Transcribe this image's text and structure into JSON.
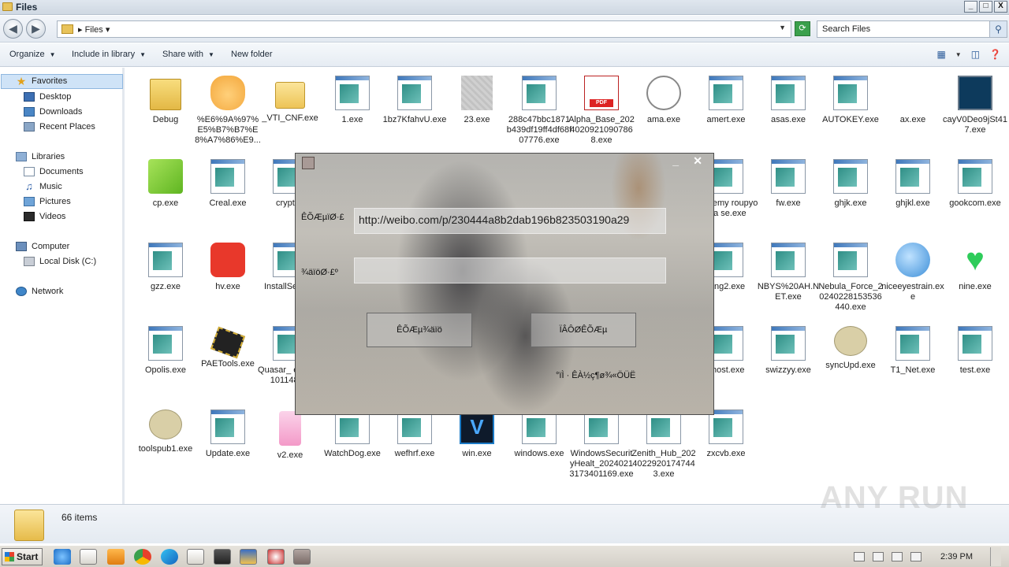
{
  "window": {
    "title": "Files",
    "min": "_",
    "max": "□",
    "close": "X"
  },
  "address": {
    "crumb": "Files",
    "search_placeholder": "Search Files"
  },
  "commands": {
    "organize": "Organize",
    "include": "Include in library",
    "share": "Share with",
    "new_folder": "New folder"
  },
  "nav": {
    "favorites": "Favorites",
    "desktop": "Desktop",
    "downloads": "Downloads",
    "recent": "Recent Places",
    "libraries": "Libraries",
    "documents": "Documents",
    "music": "Music",
    "pictures": "Pictures",
    "videos": "Videos",
    "computer": "Computer",
    "local_disk": "Local Disk (C:)",
    "network": "Network"
  },
  "files": [
    {
      "name": "Debug",
      "icon": "folder-icon"
    },
    {
      "name": "%E6%9A%97%E5%B7%B7%E8%A7%86%E9...",
      "icon": "cat-icon"
    },
    {
      "name": "_VTI_CNF.exe",
      "icon": "folder-exe-icon"
    },
    {
      "name": "1.exe",
      "icon": "exe-icon"
    },
    {
      "name": "1bz7KfahvU.exe",
      "icon": "exe-icon"
    },
    {
      "name": "23.exe",
      "icon": "blurred-icon"
    },
    {
      "name": "288c47bbc1871b439df19ff4df68f07776.exe",
      "icon": "exe-icon"
    },
    {
      "name": "Alpha_Base_20240209210907868.exe",
      "icon": "pdf-icon"
    },
    {
      "name": "ama.exe",
      "icon": "gauge-icon"
    },
    {
      "name": "amert.exe",
      "icon": "exe-icon"
    },
    {
      "name": "asas.exe",
      "icon": "exe-icon"
    },
    {
      "name": "AUTOKEY.exe",
      "icon": "exe-icon"
    },
    {
      "name": "ax.exe",
      "icon": "blank-icon"
    },
    {
      "name": "cayV0Deo9jSt417.exe",
      "icon": "terminal-icon"
    },
    {
      "name": "cp.exe",
      "icon": "cube-icon"
    },
    {
      "name": "Creal.exe",
      "icon": "exe-icon"
    },
    {
      "name": "crypted",
      "icon": "exe-icon"
    },
    {
      "name": "shovemy roupyoura se.exe",
      "icon": "exe-icon"
    },
    {
      "name": "fw.exe",
      "icon": "exe-icon"
    },
    {
      "name": "ghjk.exe",
      "icon": "exe-icon"
    },
    {
      "name": "ghjkl.exe",
      "icon": "exe-icon"
    },
    {
      "name": "gookcom.exe",
      "icon": "exe-icon"
    },
    {
      "name": "gzz.exe",
      "icon": "exe-icon"
    },
    {
      "name": "hv.exe",
      "icon": "hv-icon"
    },
    {
      "name": "InstallSe .exe",
      "icon": "exe-icon"
    },
    {
      "name": "mng2.exe",
      "icon": "exe-icon"
    },
    {
      "name": "NBYS%20AH.NET.exe",
      "icon": "exe-icon"
    },
    {
      "name": "Nebula_Force_20240228153536440.exe",
      "icon": "exe-icon"
    },
    {
      "name": "niceeyestrain.exe",
      "icon": "globe-icon"
    },
    {
      "name": "nine.exe",
      "icon": "heart-icon"
    },
    {
      "name": "Opolis.exe",
      "icon": "exe-icon"
    },
    {
      "name": "PAETools.exe",
      "icon": "chip-icon"
    },
    {
      "name": "Quasar_ e_2024 101148 xe",
      "icon": "exe-icon"
    },
    {
      "name": "chost.exe",
      "icon": "exe-icon"
    },
    {
      "name": "swizzyy.exe",
      "icon": "exe-icon"
    },
    {
      "name": "syncUpd.exe",
      "icon": "bubble-icon"
    },
    {
      "name": "T1_Net.exe",
      "icon": "exe-icon"
    },
    {
      "name": "test.exe",
      "icon": "exe-icon"
    },
    {
      "name": "toolspub1.exe",
      "icon": "bubble-icon"
    },
    {
      "name": "Update.exe",
      "icon": "exe-icon"
    },
    {
      "name": "v2.exe",
      "icon": "v2-icon"
    },
    {
      "name": "WatchDog.exe",
      "icon": "exe-icon"
    },
    {
      "name": "wefhrf.exe",
      "icon": "exe-icon"
    },
    {
      "name": "win.exe",
      "icon": "win-icon"
    },
    {
      "name": "windows.exe",
      "icon": "exe-icon"
    },
    {
      "name": "WindowsSecurityHealt_20240213173401169.exe",
      "icon": "exe-icon"
    },
    {
      "name": "Zenith_Hub_20240229201747443.exe",
      "icon": "exe-icon"
    },
    {
      "name": "zxcvb.exe",
      "icon": "exe-icon"
    }
  ],
  "dialog": {
    "min": "_",
    "close": "✕",
    "label1": "ÊÕÆµïØ·£",
    "input1": "http://weibo.com/p/230444a8b2dab196b823503190a29",
    "label2": "¾äïöØ·£º",
    "input2": "",
    "btn1": "ÊÕÆµ¾äïö",
    "btn2": "ÏÂÔØÊÕÆµ",
    "note": "°ïÌ · ÊÀ½ç¶ø¾«ÖÜË"
  },
  "status": {
    "count": "66 items"
  },
  "watermark": "ANY RUN",
  "taskbar": {
    "start": "Start",
    "time": "2:39 PM"
  }
}
